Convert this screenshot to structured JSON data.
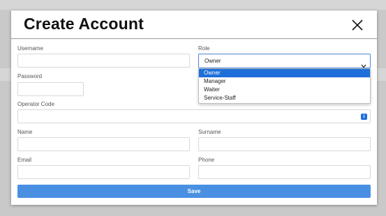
{
  "modal": {
    "title": "Create Account",
    "close_icon": "close-icon"
  },
  "form": {
    "username": {
      "label": "Username",
      "value": ""
    },
    "role": {
      "label": "Role",
      "selected": "Owner",
      "options": [
        "Owner",
        "Manager",
        "Waiter",
        "Service-Staff"
      ]
    },
    "password": {
      "label": "Password",
      "value": ""
    },
    "operator_code": {
      "label": "Operator Code",
      "value": "",
      "icon": "info-icon"
    },
    "name": {
      "label": "Name",
      "value": ""
    },
    "surname": {
      "label": "Surname",
      "value": ""
    },
    "email": {
      "label": "Email",
      "value": ""
    },
    "phone": {
      "label": "Phone",
      "value": ""
    },
    "save_label": "Save"
  },
  "colors": {
    "accent": "#1e6fd9",
    "save_button": "#4a90e2",
    "backdrop": "#c9c9c9"
  }
}
